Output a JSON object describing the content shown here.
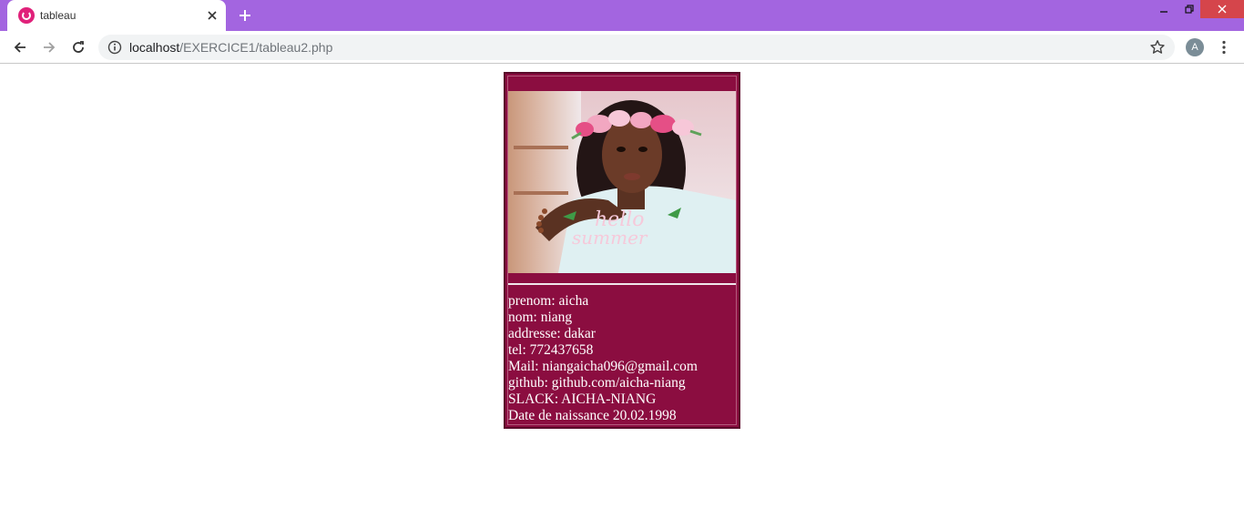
{
  "browser": {
    "tab_title": "tableau",
    "url_host": "localhost",
    "url_path": "/EXERCICE1/tableau2.php",
    "avatar_letter": "A"
  },
  "card": {
    "lines": [
      "prenom: aicha",
      "nom: niang",
      "addresse: dakar",
      "tel: 772437658",
      "Mail: niangaicha096@gmail.com",
      "github: github.com/aicha-niang",
      "SLACK: AICHA-NIANG",
      "Date de naissance 20.02.1998"
    ],
    "photo_text": "hello summer"
  },
  "colors": {
    "tabstrip": "#a365e0",
    "card_bg": "#8b0d40",
    "favicon": "#e0217a",
    "close_btn": "#d5454b"
  }
}
